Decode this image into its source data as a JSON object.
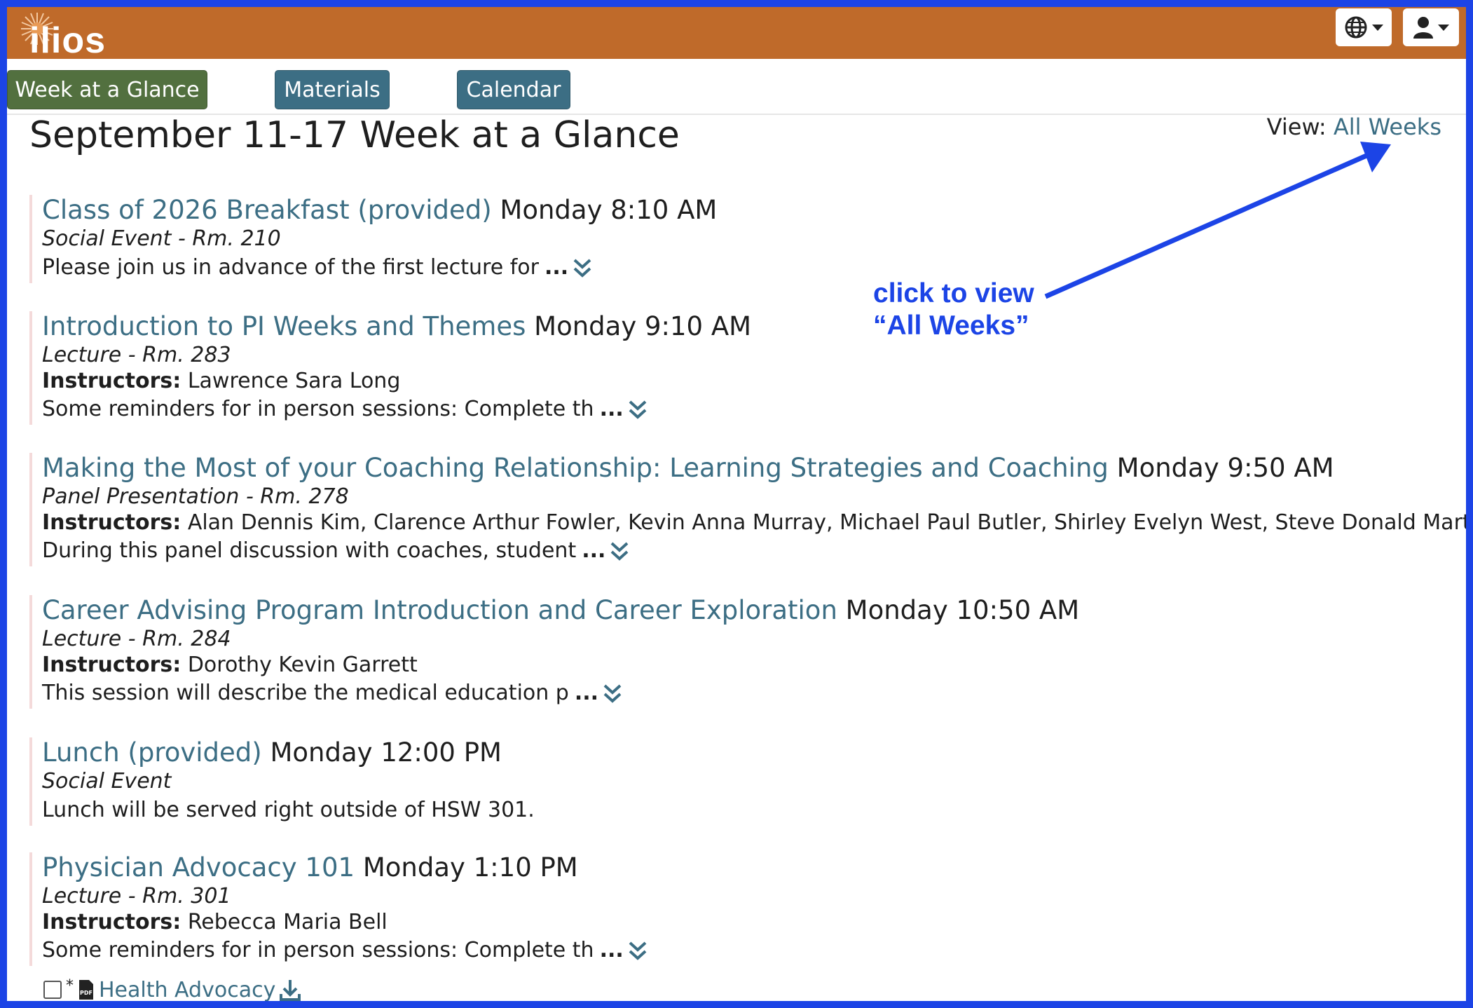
{
  "header": {
    "logo_text": "ilios",
    "language_menu_icon": "globe-icon",
    "user_menu_icon": "user-icon"
  },
  "tabs": [
    {
      "label": "Week at a Glance",
      "active": true
    },
    {
      "label": "Materials",
      "active": false
    },
    {
      "label": "Calendar",
      "active": false
    }
  ],
  "page": {
    "title": "September 11-17 Week at a Glance",
    "view_label": "View:",
    "view_link": "All Weeks"
  },
  "events": [
    {
      "title": "Class of 2026 Breakfast (provided)",
      "time": "Monday 8:10 AM",
      "type": "Social Event - Rm. 210",
      "instructors_label": "",
      "instructors": "",
      "description": "Please join us in advance of the first lecture for",
      "expandable": true
    },
    {
      "title": "Introduction to PI Weeks and Themes",
      "time": "Monday 9:10 AM",
      "type": "Lecture - Rm. 283",
      "instructors_label": "Instructors:",
      "instructors": "Lawrence Sara Long",
      "description": "Some reminders for in person sessions: Complete th",
      "expandable": true
    },
    {
      "title": "Making the Most of your Coaching Relationship: Learning Strategies and Coaching",
      "time": "Monday 9:50 AM",
      "type": "Panel Presentation - Rm. 278",
      "instructors_label": "Instructors:",
      "instructors": "Alan Dennis Kim, Clarence Arthur Fowler, Kevin Anna Murray, Michael Paul Butler, Shirley Evelyn West, Steve Donald Martinez",
      "description": "During this panel discussion with coaches, student",
      "expandable": true
    },
    {
      "title": "Career Advising Program Introduction and Career Exploration",
      "time": "Monday 10:50 AM",
      "type": "Lecture - Rm. 284",
      "instructors_label": "Instructors:",
      "instructors": "Dorothy Kevin Garrett",
      "description": "This session will describe the medical education p",
      "expandable": true
    },
    {
      "title": "Lunch (provided)",
      "time": "Monday 12:00 PM",
      "type": "Social Event",
      "instructors_label": "",
      "instructors": "",
      "description": "Lunch will be served right outside of HSW 301.",
      "expandable": false
    },
    {
      "title": "Physician Advocacy 101",
      "time": "Monday 1:10 PM",
      "type": "Lecture - Rm. 301",
      "instructors_label": "Instructors:",
      "instructors": "Rebecca Maria Bell",
      "description": "Some reminders for in person sessions: Complete th",
      "expandable": true
    }
  ],
  "ellipsis": "...",
  "material": {
    "star": "*",
    "file_icon": "pdf-file-icon",
    "pdf_label": "PDF",
    "title": "Health Advocacy",
    "download_icon": "download-icon"
  },
  "annotation": {
    "line1": "click to view",
    "line2": "“All Weeks”",
    "color": "#1c44e6"
  },
  "colors": {
    "header": "#bf6a2a",
    "tab_active": "#52703f",
    "tab_normal": "#3c6e84",
    "link": "#3c6e84"
  }
}
